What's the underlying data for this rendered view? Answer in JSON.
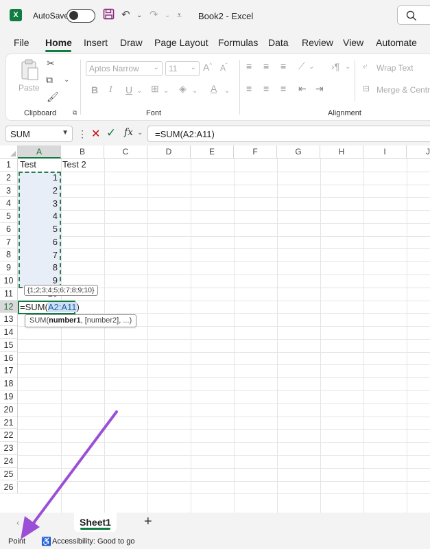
{
  "titlebar": {
    "autosave_label": "AutoSave",
    "doc_title": "Book2  -  Excel",
    "app_icon_letter": "X"
  },
  "tabs": [
    "File",
    "Home",
    "Insert",
    "Draw",
    "Page Layout",
    "Formulas",
    "Data",
    "Review",
    "View",
    "Automate"
  ],
  "active_tab": "Home",
  "ribbon": {
    "paste_label": "Paste",
    "clipboard_label": "Clipboard",
    "font_label": "Font",
    "alignment_label": "Alignment",
    "font_name": "Aptos Narrow",
    "font_size": "11",
    "wrap_text": "Wrap Text",
    "merge_center": "Merge & Centre",
    "bold": "B",
    "italic": "I",
    "underline": "U"
  },
  "formula_bar": {
    "name_box": "SUM",
    "formula": "=SUM(A2:A11)",
    "fx": "fx"
  },
  "grid": {
    "columns": [
      "A",
      "B",
      "C",
      "D",
      "E",
      "F",
      "G",
      "H",
      "I",
      "J"
    ],
    "rows": [
      "1",
      "2",
      "3",
      "4",
      "5",
      "6",
      "7",
      "8",
      "9",
      "10",
      "11",
      "12",
      "13",
      "14",
      "15",
      "16",
      "17",
      "18",
      "19",
      "20",
      "21",
      "22",
      "23",
      "24",
      "25",
      "26"
    ],
    "a1": "Test",
    "b1": "Test 2",
    "values": [
      "1",
      "2",
      "3",
      "4",
      "5",
      "6",
      "7",
      "8",
      "9",
      "10"
    ],
    "array_tooltip": "{1;2;3;4;5;6;7;8;9;10}",
    "edit_prefix": "=SUM(",
    "edit_ref": "A2:A11",
    "edit_suffix": ")",
    "fn_tip_name": "SUM(",
    "fn_tip_arg1": "number1",
    "fn_tip_rest": ", [number2], ...)"
  },
  "sheets": {
    "active": "Sheet1",
    "add": "+"
  },
  "status": {
    "mode": "Point",
    "accessibility": "Accessibility: Good to go"
  },
  "colors": {
    "accent": "#107c41",
    "annotation_arrow": "#9b4fd6",
    "selection_fill": "#e8eef8"
  }
}
